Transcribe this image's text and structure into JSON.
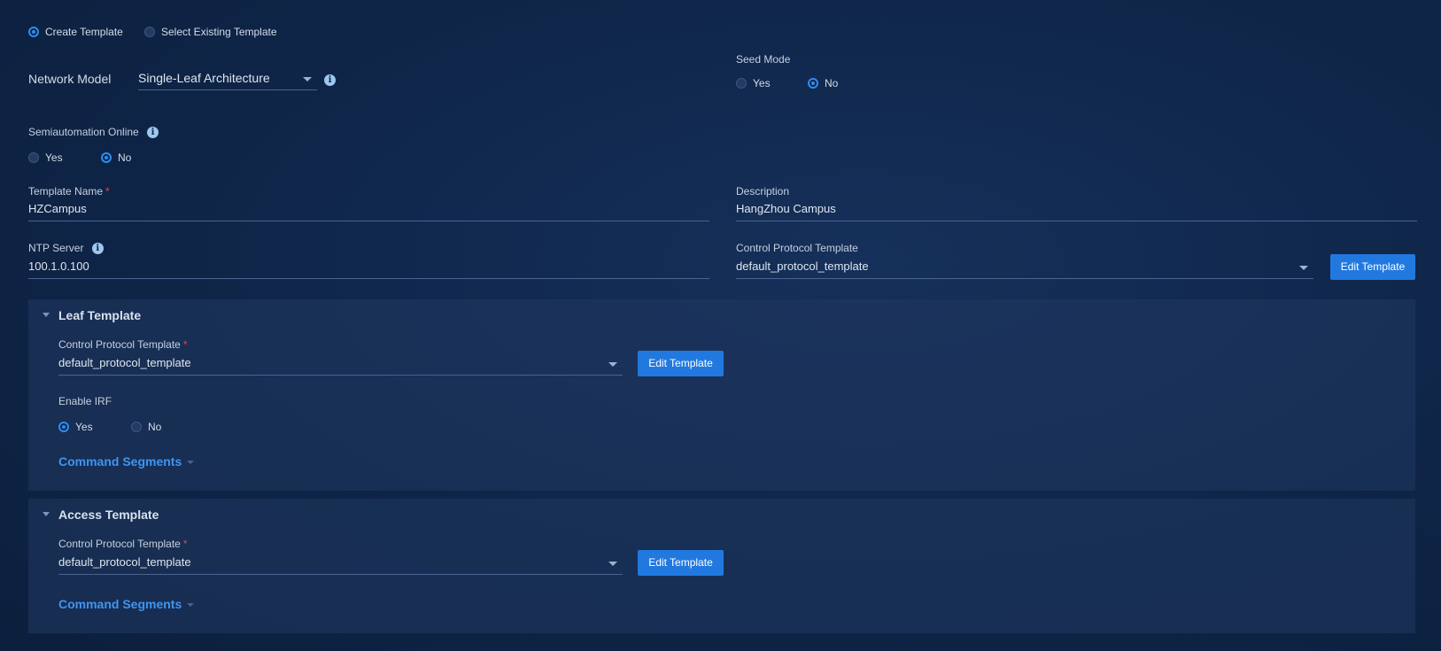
{
  "template_mode": {
    "options": [
      "Create Template",
      "Select Existing Template"
    ],
    "selected": "Create Template"
  },
  "network_model": {
    "label": "Network Model",
    "value": "Single-Leaf Architecture"
  },
  "seed_mode": {
    "label": "Seed Mode",
    "yes": "Yes",
    "no": "No",
    "selected": "No"
  },
  "semiautomation": {
    "label": "Semiautomation Online",
    "yes": "Yes",
    "no": "No",
    "selected": "No"
  },
  "template_name": {
    "label": "Template Name",
    "value": "HZCampus",
    "required_mark": "*"
  },
  "description": {
    "label": "Description",
    "value": "HangZhou Campus"
  },
  "ntp_server": {
    "label": "NTP Server",
    "value": "100.1.0.100"
  },
  "control_protocol": {
    "label": "Control Protocol Template",
    "value": "default_protocol_template",
    "button": "Edit Template"
  },
  "leaf_template": {
    "title": "Leaf Template",
    "cp_label": "Control Protocol Template",
    "cp_required_mark": "*",
    "cp_value": "default_protocol_template",
    "button": "Edit Template",
    "irf_label": "Enable IRF",
    "irf_yes": "Yes",
    "irf_no": "No",
    "irf_selected": "Yes",
    "command_segments": "Command Segments"
  },
  "access_template": {
    "title": "Access Template",
    "cp_label": "Control Protocol Template",
    "cp_required_mark": "*",
    "cp_value": "default_protocol_template",
    "button": "Edit Template",
    "command_segments": "Command Segments"
  },
  "info_icon_glyph": "i",
  "colors": {
    "accent": "#2f8cf0",
    "button": "#2179e0",
    "link": "#3f95f2",
    "required": "#e8453c"
  }
}
